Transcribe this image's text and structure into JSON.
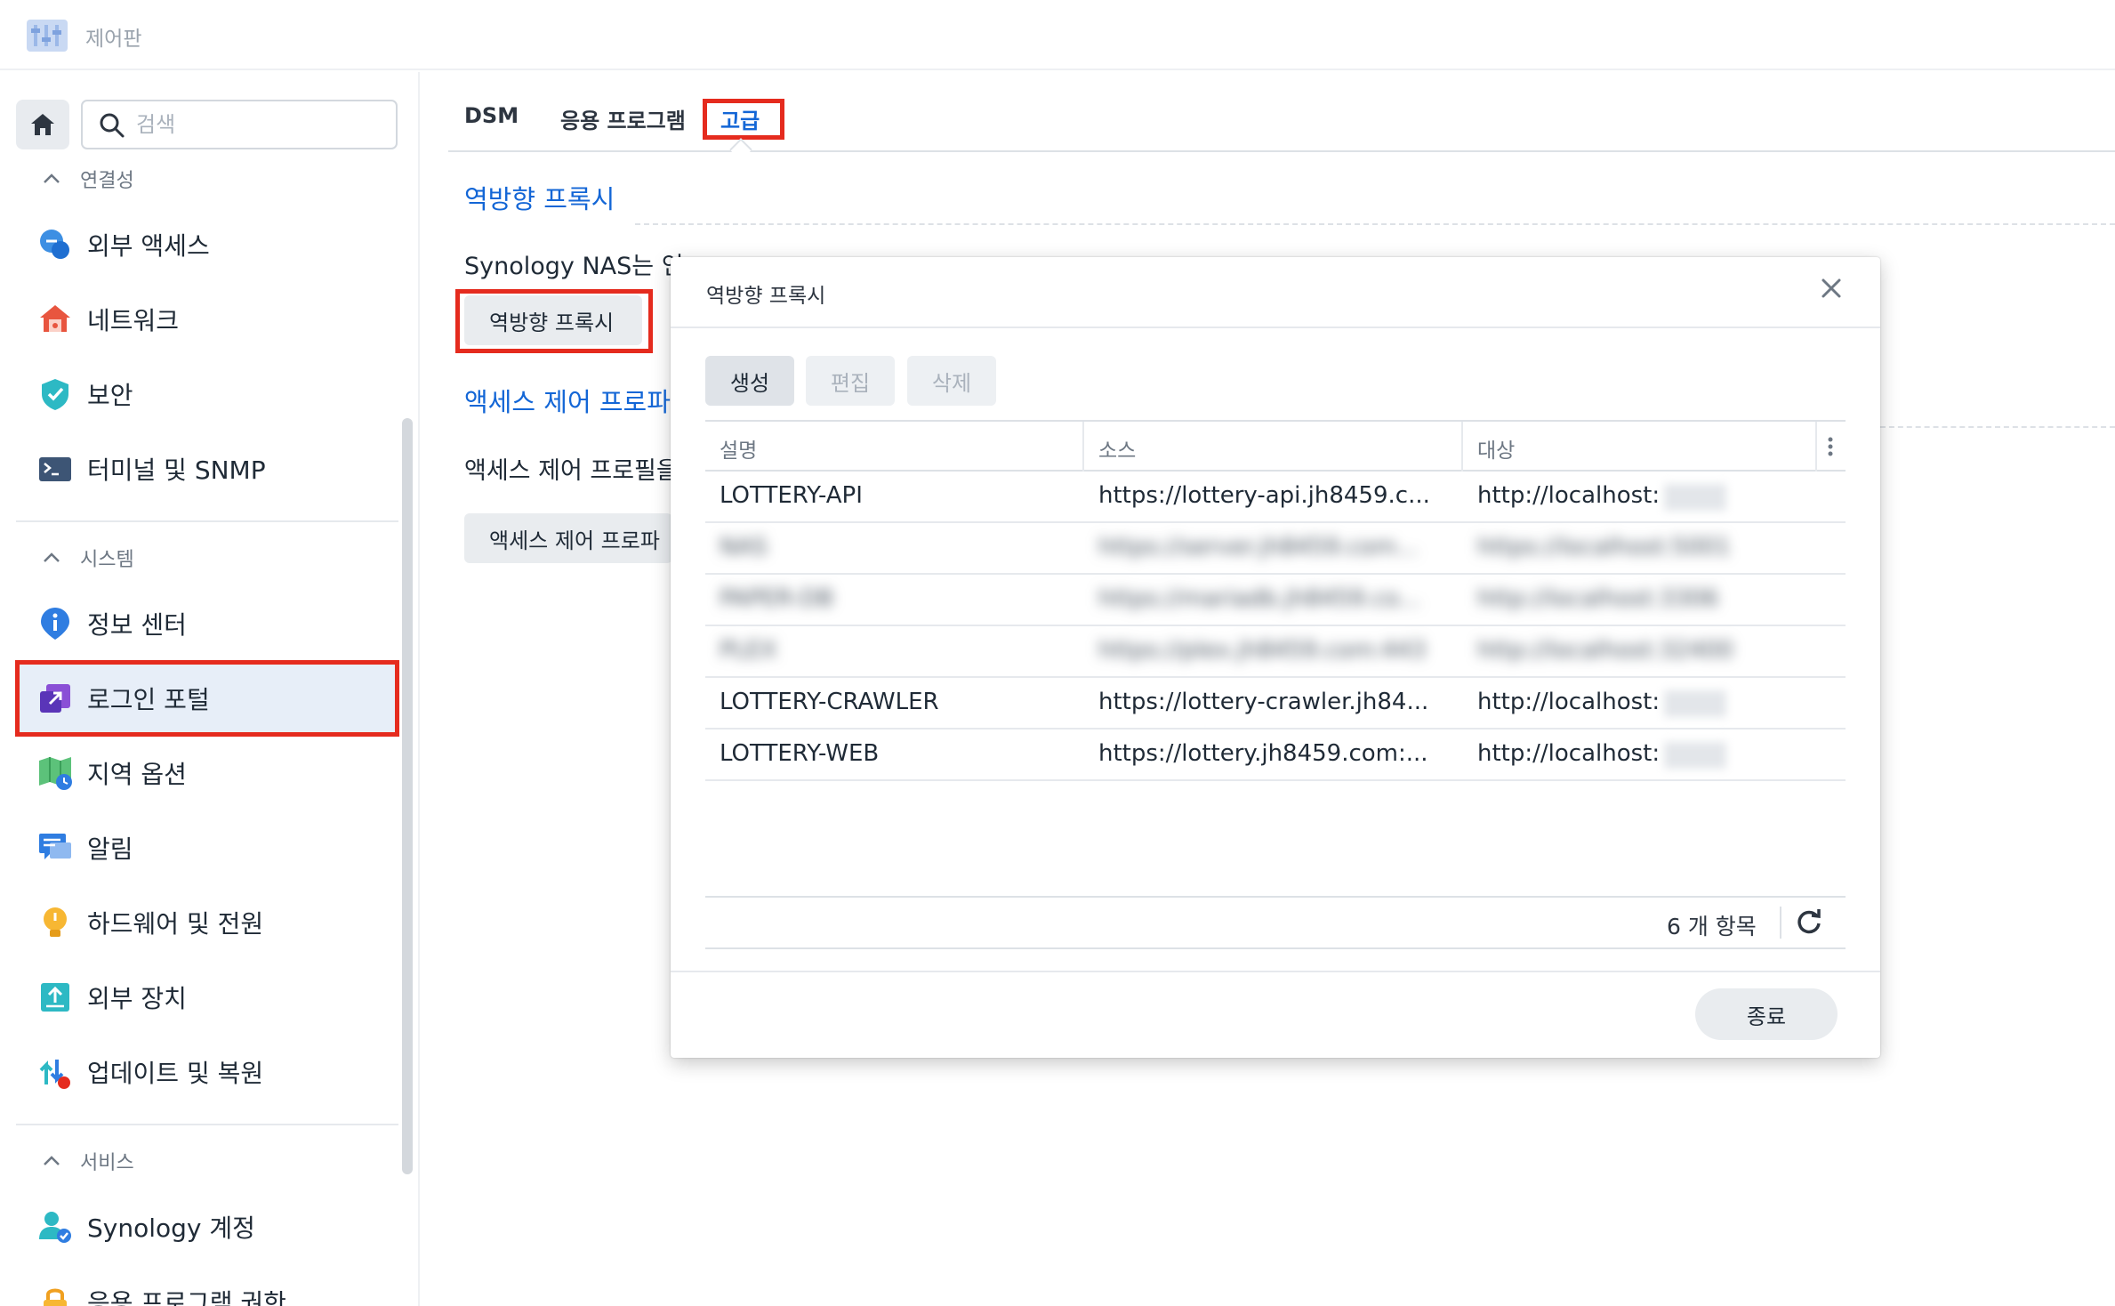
{
  "header": {
    "title": "제어판",
    "logo_icon": "control-panel-icon"
  },
  "search": {
    "placeholder": "검색"
  },
  "tabs": [
    {
      "label": "DSM"
    },
    {
      "label": "응용 프로그램"
    },
    {
      "label": "고급",
      "active": true
    }
  ],
  "sidebar": {
    "sections": [
      {
        "label": "연결성",
        "items": [
          {
            "label": "외부 액세스",
            "icon": "external-access-icon"
          },
          {
            "label": "네트워크",
            "icon": "network-icon"
          },
          {
            "label": "보안",
            "icon": "security-shield-icon"
          },
          {
            "label": "터미널 및 SNMP",
            "icon": "terminal-icon"
          }
        ]
      },
      {
        "label": "시스템",
        "items": [
          {
            "label": "정보 센터",
            "icon": "info-icon"
          },
          {
            "label": "로그인 포털",
            "icon": "login-portal-icon",
            "active": true
          },
          {
            "label": "지역 옵션",
            "icon": "regional-options-icon"
          },
          {
            "label": "알림",
            "icon": "notification-icon"
          },
          {
            "label": "하드웨어 및 전원",
            "icon": "hardware-power-icon"
          },
          {
            "label": "외부 장치",
            "icon": "external-devices-icon"
          },
          {
            "label": "업데이트 및 복원",
            "icon": "update-restore-icon"
          }
        ]
      },
      {
        "label": "서비스",
        "items": [
          {
            "label": "Synology 계정",
            "icon": "synology-account-icon"
          },
          {
            "label": "응용 프로그램 권한",
            "icon": "app-privileges-icon"
          }
        ]
      }
    ]
  },
  "main": {
    "reverse_proxy": {
      "title": "역방향 프록시",
      "description": "Synology NAS는 인",
      "button": "역방향 프록시"
    },
    "access_control": {
      "title": "액세스 제어 프로파",
      "description": "액세스 제어 프로필을",
      "button": "액세스 제어 프로파"
    }
  },
  "dialog": {
    "title": "역방향 프록시",
    "toolbar": {
      "create": "생성",
      "edit": "편집",
      "delete": "삭제"
    },
    "columns": {
      "description": "설명",
      "source": "소스",
      "destination": "대상"
    },
    "rows": [
      {
        "description": "LOTTERY-API",
        "source": "https://lottery-api.jh8459.c...",
        "destination": "http://localhost:",
        "blurred": false
      },
      {
        "description": "NAS",
        "source": "https://server.jh8459.com...",
        "destination": "https://localhost:5001",
        "blurred": true
      },
      {
        "description": "PAPER-DB",
        "source": "https://mariadb.jh8459.co...",
        "destination": "http://localhost:3306",
        "blurred": true
      },
      {
        "description": "PLEX",
        "source": "https://plex.jh8459.com:443",
        "destination": "http://localhost:32400",
        "blurred": true
      },
      {
        "description": "LOTTERY-CRAWLER",
        "source": "https://lottery-crawler.jh84...",
        "destination": "http://localhost:",
        "blurred": false
      },
      {
        "description": "LOTTERY-WEB",
        "source": "https://lottery.jh8459.com:...",
        "destination": "http://localhost:",
        "blurred": false
      }
    ],
    "item_count": "6 개 항목",
    "close_button": "종료"
  },
  "colors": {
    "accent": "#1366d6",
    "highlight": "#e52b1e"
  }
}
